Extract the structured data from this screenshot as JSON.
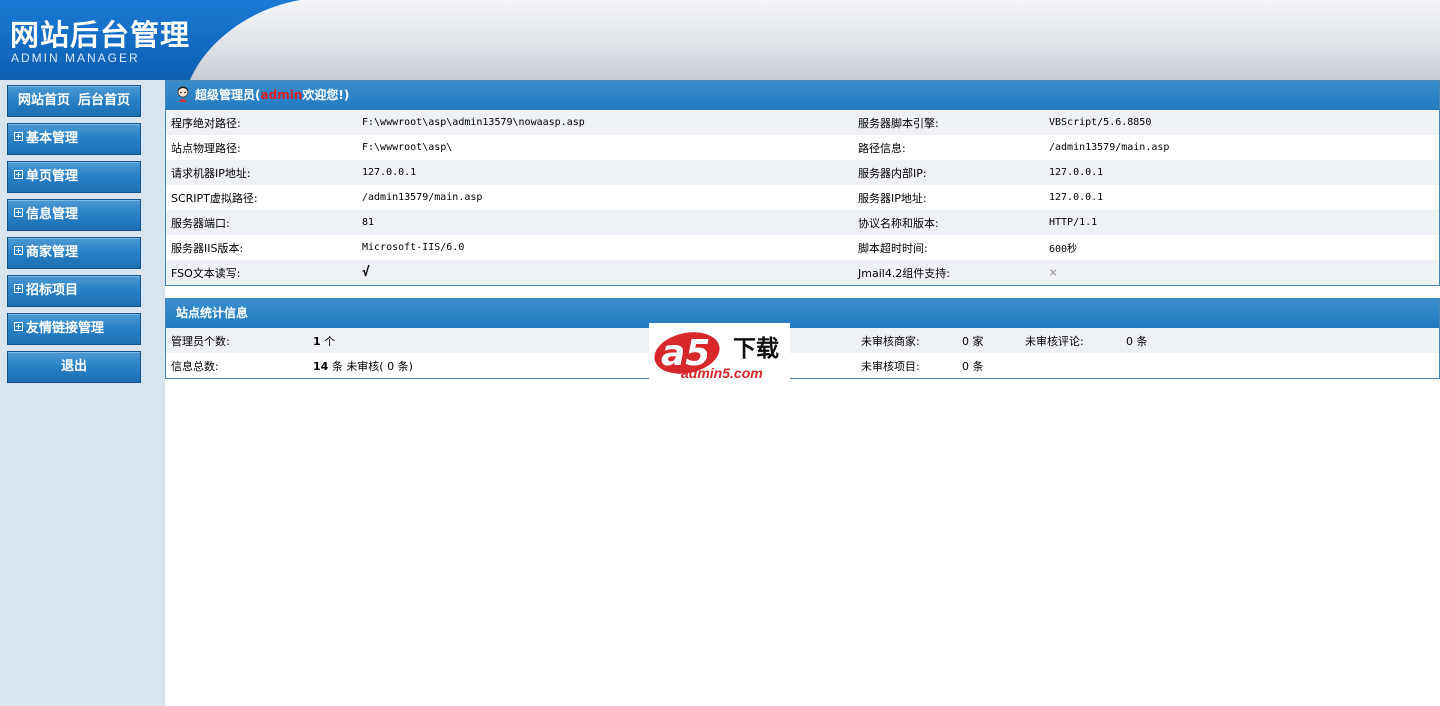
{
  "header": {
    "title": "网站后台管理",
    "subtitle": "ADMIN MANAGER"
  },
  "sidebar": {
    "top": {
      "home": "网站首页",
      "admin_home": "后台首页"
    },
    "items": [
      {
        "label": "基本管理"
      },
      {
        "label": "单页管理"
      },
      {
        "label": "信息管理"
      },
      {
        "label": "商家管理"
      },
      {
        "label": "招标项目"
      },
      {
        "label": "友情链接管理"
      }
    ],
    "logout": "退出"
  },
  "welcome": {
    "prefix": "超级管理员(",
    "username": "admin",
    "suffix": "欢迎您!)"
  },
  "server_info": [
    {
      "label": "程序绝对路径:",
      "value": "F:\\wwwroot\\asp\\admin13579\\nowaasp.asp",
      "label2": "服务器脚本引擎:",
      "value2": "VBScript/5.6.8850"
    },
    {
      "label": "站点物理路径:",
      "value": "F:\\wwwroot\\asp\\",
      "label2": "路径信息:",
      "value2": "/admin13579/main.asp"
    },
    {
      "label": "请求机器IP地址:",
      "value": "127.0.0.1",
      "label2": "服务器内部IP:",
      "value2": "127.0.0.1"
    },
    {
      "label": "SCRIPT虚拟路径:",
      "value": "/admin13579/main.asp",
      "label2": "服务器IP地址:",
      "value2": "127.0.0.1"
    },
    {
      "label": "服务器端口:",
      "value": "81",
      "label2": "协议名称和版本:",
      "value2": "HTTP/1.1"
    },
    {
      "label": "服务器IIS版本:",
      "value": "Microsoft-IIS/6.0",
      "label2": "脚本超时时间:",
      "value2": "600秒"
    },
    {
      "label": "FSO文本读写:",
      "value": "√",
      "label2": "Jmail4.2组件支持:",
      "value2": "×"
    }
  ],
  "stats": {
    "title": "站点统计信息",
    "admin_count_label": "管理员个数:",
    "admin_count": "1",
    "admin_count_unit": "个",
    "info_total_label": "信息总数:",
    "info_total": "14",
    "info_total_unit": "条 未审核(",
    "info_unreviewed": "0",
    "info_unreviewed_unit": "条)",
    "unreviewed_merchants_label": "未审核商家:",
    "unreviewed_merchants": "0",
    "unreviewed_merchants_unit": "家",
    "unreviewed_comments_label": "未审核评论:",
    "unreviewed_comments": "0",
    "unreviewed_comments_unit": "条",
    "unreviewed_projects_label": "未审核项目:",
    "unreviewed_projects": "0",
    "unreviewed_projects_unit": "条"
  },
  "watermark": {
    "brand": "a5",
    "download": "下载",
    "site": "admin5.com"
  },
  "colors": {
    "header_blue": "#1470c8",
    "panel_blue": "#2179be",
    "sidebar_bg": "#d9e4f1",
    "username_red": "#e02020"
  }
}
